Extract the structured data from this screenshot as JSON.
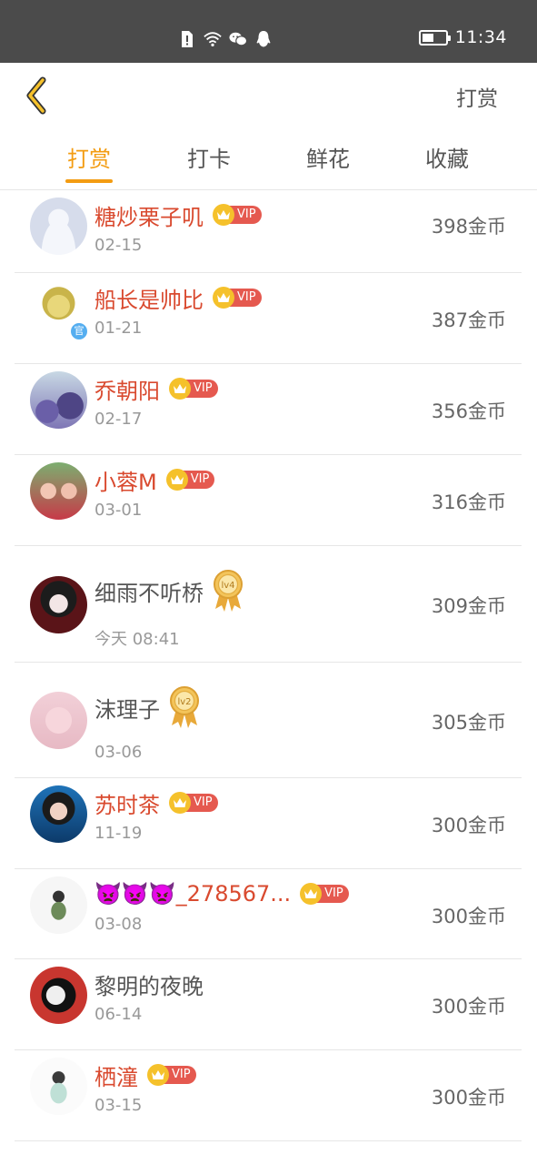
{
  "status_bar": {
    "time": "11:34",
    "icons": [
      "sim-alert-icon",
      "wifi-icon",
      "wechat-icon",
      "qq-icon"
    ],
    "battery_level": 0.5
  },
  "header": {
    "back_icon": "chevron-left-icon",
    "title": "打赏"
  },
  "tabs": [
    {
      "label": "打赏",
      "active": true
    },
    {
      "label": "打卡",
      "active": false
    },
    {
      "label": "鲜花",
      "active": false
    },
    {
      "label": "收藏",
      "active": false
    }
  ],
  "colors": {
    "accent": "#f39c12",
    "vip_name": "#d94a2f",
    "vip_badge": "#e5594f",
    "crown": "#f5c12b",
    "status_bar": "#4b4b4b"
  },
  "vip_label": "VIP",
  "official_label": "官",
  "rows": [
    {
      "name": "糖炒栗子叽",
      "date": "02-15",
      "amount": "398金币",
      "vip": true
    },
    {
      "name": "船长是帅比",
      "date": "01-21",
      "amount": "387金币",
      "vip": true,
      "official": true
    },
    {
      "name": "乔朝阳",
      "date": "02-17",
      "amount": "356金币",
      "vip": true
    },
    {
      "name": "小蓉M",
      "date": "03-01",
      "amount": "316金币",
      "vip": true
    },
    {
      "name": "细雨不听桥",
      "date": "今天 08:41",
      "amount": "309金币",
      "vip": false,
      "level": "lv4"
    },
    {
      "name": "沫理子",
      "date": "03-06",
      "amount": "305金币",
      "vip": false,
      "level": "lv2"
    },
    {
      "name": "苏时茶",
      "date": "11-19",
      "amount": "300金币",
      "vip": true
    },
    {
      "name": "👿👿👿_278567...",
      "date": "03-08",
      "amount": "300金币",
      "vip": true
    },
    {
      "name": "黎明的夜晚",
      "date": "06-14",
      "amount": "300金币",
      "vip": false
    },
    {
      "name": "栖潼",
      "date": "03-15",
      "amount": "300金币",
      "vip": true
    }
  ]
}
